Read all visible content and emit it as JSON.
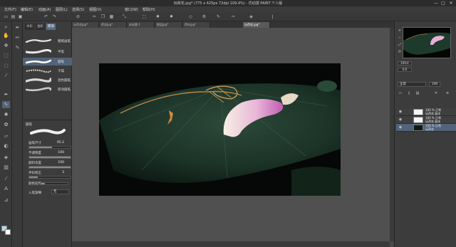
{
  "app": {
    "title": "玩荷花.jpg* (775 x 425px 72dpi 109.4%) - 优动漫 PAINT 个人版",
    "window_controls": [
      "—",
      "□",
      "✕"
    ]
  },
  "menu": [
    "文件(F)",
    "编辑(E)",
    "动画(A)",
    "图层(L)",
    "选择(S)",
    "视图(V)",
    "窗口(W)",
    "帮助(H)"
  ],
  "command_icons": [
    "new-doc-icon",
    "open-icon",
    "save-icon",
    "undo-icon",
    "redo-icon",
    "clear-icon",
    "cut-icon",
    "copy-icon",
    "paste-icon",
    "transform-icon",
    "deselect-icon",
    "invert-selection-icon",
    "show-area-icon",
    "select-all-icon",
    "settings-icon",
    "brush-icon",
    "pen-icon",
    "fill-icon",
    "ruler-icon"
  ],
  "doc_tabs": [
    {
      "label": "玩荷花jpg*",
      "active": false
    },
    {
      "label": "荷花jpg*",
      "active": false
    },
    {
      "label": "未标题-1",
      "active": false
    },
    {
      "label": "图层jpg*",
      "active": false
    },
    {
      "label": "荷叶jpg*",
      "active": false
    },
    {
      "label": "玩荷花.jpg*",
      "active": true
    }
  ],
  "brush_panel": {
    "tabs": [
      {
        "label": "水彩",
        "active": false
      },
      {
        "label": "油彩",
        "active": false
      },
      {
        "label": "厚涂",
        "active": true
      }
    ],
    "brushes": [
      {
        "name": "粗糙画笔",
        "selected": false
      },
      {
        "name": "平笔",
        "selected": false
      },
      {
        "name": "圆笔",
        "selected": true
      },
      {
        "name": "干燥",
        "selected": false
      },
      {
        "name": "混色圆笔",
        "selected": false
      },
      {
        "name": "厚涂圆笔",
        "selected": false
      }
    ]
  },
  "tool_props": {
    "header": "圆笔",
    "items": [
      {
        "label": "画笔尺寸",
        "value": "95.2",
        "fill": 0.55
      },
      {
        "label": "不透明度",
        "value": "100",
        "fill": 1.0
      },
      {
        "label": "颜料浓度",
        "value": "100",
        "fill": 1.0
      },
      {
        "label": "手抖修正",
        "value": "3",
        "fill": 0.2
      },
      {
        "label": "颜色延伸",
        "value": "",
        "fill": 0.15
      },
      {
        "label": "入笔渐细",
        "value": "无",
        "fill": 0
      }
    ]
  },
  "navigator": {
    "zoom": "109.4",
    "angle": "0.0"
  },
  "layer_panel": {
    "blend_mode": "正常",
    "opacity": "100",
    "layers": [
      {
        "name1": "100 % 正常",
        "name2": "玩荷花 副本",
        "selected": false
      },
      {
        "name1": "100 % 正常",
        "name2": "玩荷花 副本",
        "selected": false
      },
      {
        "name1": "100 % 正常",
        "name2": "玩荷花",
        "selected": true
      }
    ]
  },
  "colors": {
    "main": "#b7d9ec",
    "sub": "#ffffff",
    "accent": "#52637a"
  }
}
